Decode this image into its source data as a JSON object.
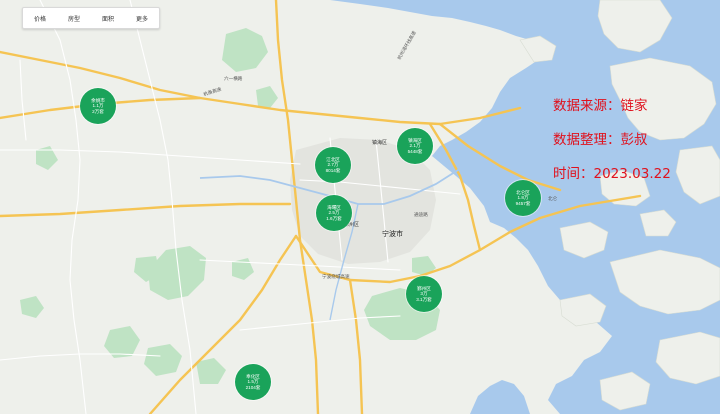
{
  "filters": [
    {
      "label": "价格"
    },
    {
      "label": "房型"
    },
    {
      "label": "面积"
    },
    {
      "label": "更多"
    }
  ],
  "clusters": [
    {
      "district": "余姚市",
      "count": "1.1万",
      "price": "2万套"
    },
    {
      "district": "江北区",
      "count": "2.7万",
      "price": "8014套"
    },
    {
      "district": "镇海区",
      "count": "2.1万",
      "price": "5448套"
    },
    {
      "district": "海曙区",
      "count": "2.5万",
      "price": "1.6万套"
    },
    {
      "district": "北仑区",
      "count": "1.8万",
      "price": "9457套"
    },
    {
      "district": "鄞州区",
      "count": "3万",
      "price": "3.1万套"
    },
    {
      "district": "奉化区",
      "count": "1.5万",
      "price": "2104套"
    }
  ],
  "info": {
    "source": "数据来源：链家",
    "editor": "数据整理：彭叔",
    "time": "时间：2023.03.22"
  },
  "places": {
    "city": "宁波市",
    "zhenhai": "镇海区",
    "yinzhou": "鄞州区",
    "expressway": "杭州湾环线高速",
    "hangyong": "杭甬高速",
    "liuheng": "六一横路",
    "beilun": "北仑",
    "tongtu": "通途路",
    "ningbo_ring": "宁波绕城高速"
  },
  "colors": {
    "cluster": "#1aa35a",
    "sea": "#a8c9ec",
    "land": "#eef0eb",
    "park": "#bfe3c4",
    "info_text": "#e0111d"
  }
}
